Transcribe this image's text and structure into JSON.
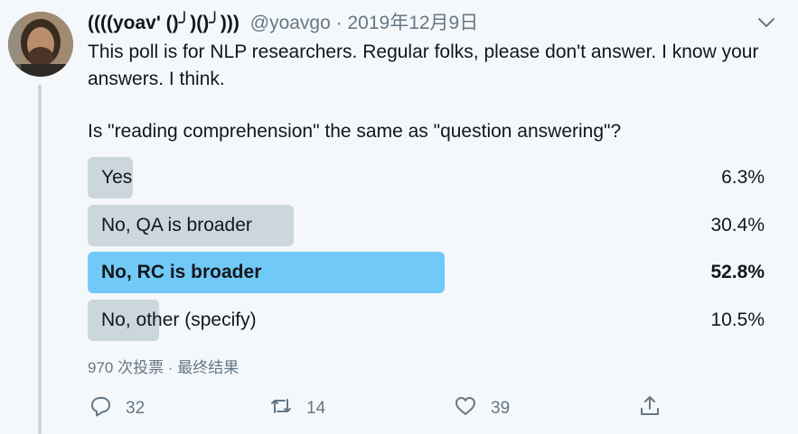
{
  "tweet": {
    "display_name": "((((yoav' ()╯)()╯)))",
    "handle": "@yoavgo",
    "separator": "·",
    "date": "2019年12月9日",
    "text_line1": "This poll is for NLP researchers. Regular folks, please don't answer. I know your answers. I think.",
    "text_line2": "Is \"reading comprehension\" the same as \"question answering\"?"
  },
  "poll": {
    "options": [
      {
        "label": "Yes",
        "percent_text": "6.3%",
        "percent": 6.3,
        "winner": false
      },
      {
        "label": "No, QA is broader",
        "percent_text": "30.4%",
        "percent": 30.4,
        "winner": false
      },
      {
        "label": "No, RC is broader",
        "percent_text": "52.8%",
        "percent": 52.8,
        "winner": true
      },
      {
        "label": "No, other (specify)",
        "percent_text": "10.5%",
        "percent": 10.5,
        "winner": false
      }
    ],
    "meta": "970 次投票 · 最终结果"
  },
  "actions": {
    "reply_count": "32",
    "retweet_count": "14",
    "like_count": "39"
  },
  "icons": [
    "avatar",
    "chevron-down-icon",
    "reply-icon",
    "retweet-icon",
    "like-icon",
    "share-icon"
  ],
  "colors": {
    "bar": "#ccd6dd",
    "winner_bar": "#71c9f8",
    "muted": "#657786",
    "text": "#14171a"
  }
}
